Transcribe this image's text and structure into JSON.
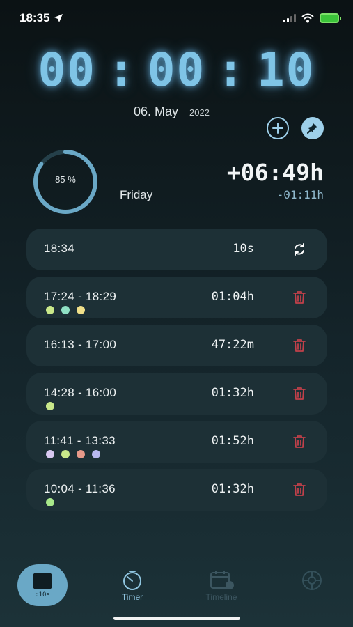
{
  "status_bar": {
    "time": "18:35"
  },
  "timer": {
    "hours": "00",
    "minutes": "00",
    "seconds": "10",
    "separator": ":"
  },
  "date": {
    "day_month": "06. May",
    "year": "2022"
  },
  "summary": {
    "progress_percent": 85,
    "progress_label": "85 %",
    "weekday": "Friday",
    "overtime": "+06:49h",
    "deficit": "-01:11h"
  },
  "entries": [
    {
      "range": "18:34",
      "duration": "10s",
      "action": "refresh-icon",
      "tags": []
    },
    {
      "range": "17:24 - 18:29",
      "duration": "01:04h",
      "action": "trash-icon",
      "tags": [
        "#c9e88a",
        "#8fe0c4",
        "#f0e08a"
      ]
    },
    {
      "range": "16:13 - 17:00",
      "duration": "47:22m",
      "action": "trash-icon",
      "tags": []
    },
    {
      "range": "14:28 - 16:00",
      "duration": "01:32h",
      "action": "trash-icon",
      "tags": [
        "#c9e88a"
      ]
    },
    {
      "range": "11:41 - 13:33",
      "duration": "01:52h",
      "action": "trash-icon",
      "tags": [
        "#d8c8f0",
        "#c9e88a",
        "#e89a8a",
        "#b8b8f0"
      ]
    },
    {
      "range": "10:04 - 11:36",
      "duration": "01:32h",
      "action": "trash-icon",
      "tags": [
        "#a8e88a"
      ]
    }
  ],
  "tabs": [
    {
      "label": ":10s",
      "icon": "stopwatch-square-icon",
      "active": true
    },
    {
      "label": "Timer",
      "icon": "timer-icon"
    },
    {
      "label": "Timeline",
      "icon": "calendar-icon"
    },
    {
      "label": "",
      "icon": "settings-icon"
    }
  ],
  "colors": {
    "accent": "#7fc4e6",
    "delete": "#c0404a",
    "card": "#1d3036"
  }
}
